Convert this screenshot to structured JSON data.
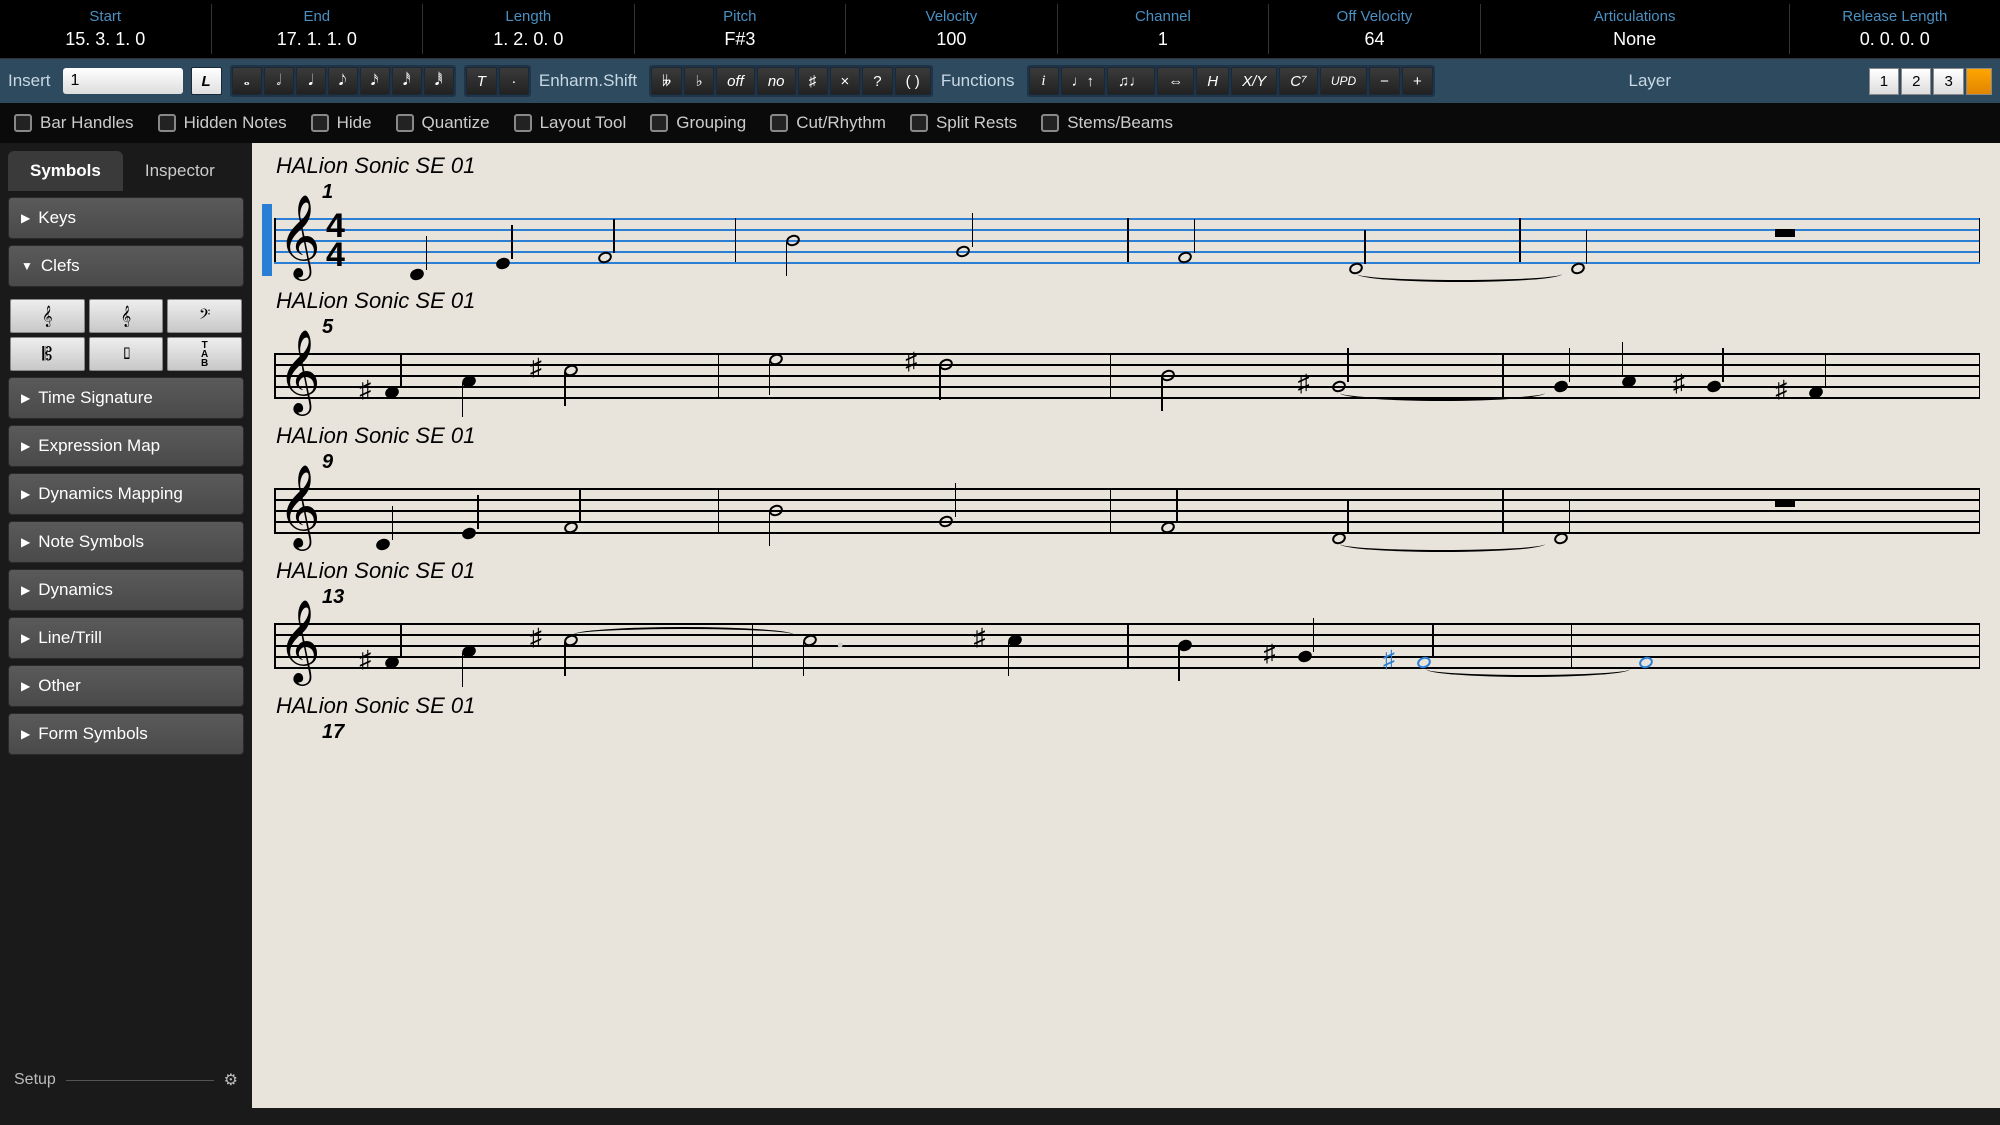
{
  "info_bar": [
    {
      "label": "Start",
      "value": "15.  3.  1.    0"
    },
    {
      "label": "End",
      "value": "17.  1.  1.    0"
    },
    {
      "label": "Length",
      "value": "1.  2.  0.    0"
    },
    {
      "label": "Pitch",
      "value": "F#3"
    },
    {
      "label": "Velocity",
      "value": "100"
    },
    {
      "label": "Channel",
      "value": "1"
    },
    {
      "label": "Off Velocity",
      "value": "64"
    },
    {
      "label": "Articulations",
      "value": "None"
    },
    {
      "label": "Release Length",
      "value": "0.  0.  0.    0"
    }
  ],
  "toolbar": {
    "insert_label": "Insert",
    "insert_value": "1",
    "l_button": "L",
    "note_values": [
      "𝅝",
      "𝅗𝅥",
      "𝅘𝅥",
      "𝅘𝅥𝅮",
      "𝅘𝅥𝅯",
      "𝅘𝅥𝅰",
      "𝅘𝅥𝅱"
    ],
    "tuplet": "T",
    "dot": "·",
    "enharm_label": "Enharm.Shift",
    "enharm_buttons": [
      "𝄫",
      "♭",
      "off",
      "no",
      "♯",
      "×",
      "?",
      "( )"
    ],
    "functions_label": "Functions",
    "function_buttons": [
      "i",
      "♩↑",
      "♫♩",
      "⇔",
      "H",
      "X/Y",
      "C⁷",
      "UPD",
      "−",
      "+"
    ],
    "layer_label": "Layer",
    "layers": [
      "1",
      "2",
      "3"
    ]
  },
  "options": [
    "Bar Handles",
    "Hidden Notes",
    "Hide",
    "Quantize",
    "Layout Tool",
    "Grouping",
    "Cut/Rhythm",
    "Split Rests",
    "Stems/Beams"
  ],
  "sidebar": {
    "tabs": [
      "Symbols",
      "Inspector"
    ],
    "items": [
      {
        "label": "Keys",
        "open": false
      },
      {
        "label": "Clefs",
        "open": true
      },
      {
        "label": "Time Signature",
        "open": false
      },
      {
        "label": "Expression Map",
        "open": false
      },
      {
        "label": "Dynamics Mapping",
        "open": false
      },
      {
        "label": "Note Symbols",
        "open": false
      },
      {
        "label": "Dynamics",
        "open": false
      },
      {
        "label": "Line/Trill",
        "open": false
      },
      {
        "label": "Other",
        "open": false
      },
      {
        "label": "Form Symbols",
        "open": false
      }
    ],
    "clef_glyphs": [
      "𝄞",
      "𝄞",
      "𝄢",
      "𝄡",
      "𝄦",
      "TAB"
    ],
    "setup": "Setup"
  },
  "score": {
    "track_name": "HALion Sonic SE 01",
    "time_sig_top": "4",
    "time_sig_bottom": "4",
    "systems": [
      {
        "bar": "1",
        "active": true
      },
      {
        "bar": "5",
        "active": false
      },
      {
        "bar": "9",
        "active": false
      },
      {
        "bar": "13",
        "active": false
      },
      {
        "bar": "17",
        "active": false
      }
    ]
  }
}
